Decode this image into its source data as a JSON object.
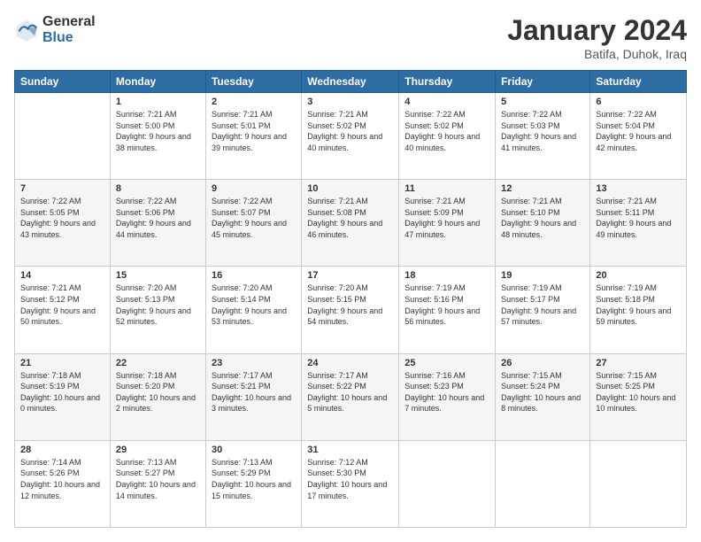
{
  "logo": {
    "general": "General",
    "blue": "Blue"
  },
  "title": "January 2024",
  "subtitle": "Batifa, Duhok, Iraq",
  "headers": [
    "Sunday",
    "Monday",
    "Tuesday",
    "Wednesday",
    "Thursday",
    "Friday",
    "Saturday"
  ],
  "weeks": [
    [
      {
        "day": "",
        "sunrise": "",
        "sunset": "",
        "daylight": ""
      },
      {
        "day": "1",
        "sunrise": "Sunrise: 7:21 AM",
        "sunset": "Sunset: 5:00 PM",
        "daylight": "Daylight: 9 hours and 38 minutes."
      },
      {
        "day": "2",
        "sunrise": "Sunrise: 7:21 AM",
        "sunset": "Sunset: 5:01 PM",
        "daylight": "Daylight: 9 hours and 39 minutes."
      },
      {
        "day": "3",
        "sunrise": "Sunrise: 7:21 AM",
        "sunset": "Sunset: 5:02 PM",
        "daylight": "Daylight: 9 hours and 40 minutes."
      },
      {
        "day": "4",
        "sunrise": "Sunrise: 7:22 AM",
        "sunset": "Sunset: 5:02 PM",
        "daylight": "Daylight: 9 hours and 40 minutes."
      },
      {
        "day": "5",
        "sunrise": "Sunrise: 7:22 AM",
        "sunset": "Sunset: 5:03 PM",
        "daylight": "Daylight: 9 hours and 41 minutes."
      },
      {
        "day": "6",
        "sunrise": "Sunrise: 7:22 AM",
        "sunset": "Sunset: 5:04 PM",
        "daylight": "Daylight: 9 hours and 42 minutes."
      }
    ],
    [
      {
        "day": "7",
        "sunrise": "Sunrise: 7:22 AM",
        "sunset": "Sunset: 5:05 PM",
        "daylight": "Daylight: 9 hours and 43 minutes."
      },
      {
        "day": "8",
        "sunrise": "Sunrise: 7:22 AM",
        "sunset": "Sunset: 5:06 PM",
        "daylight": "Daylight: 9 hours and 44 minutes."
      },
      {
        "day": "9",
        "sunrise": "Sunrise: 7:22 AM",
        "sunset": "Sunset: 5:07 PM",
        "daylight": "Daylight: 9 hours and 45 minutes."
      },
      {
        "day": "10",
        "sunrise": "Sunrise: 7:21 AM",
        "sunset": "Sunset: 5:08 PM",
        "daylight": "Daylight: 9 hours and 46 minutes."
      },
      {
        "day": "11",
        "sunrise": "Sunrise: 7:21 AM",
        "sunset": "Sunset: 5:09 PM",
        "daylight": "Daylight: 9 hours and 47 minutes."
      },
      {
        "day": "12",
        "sunrise": "Sunrise: 7:21 AM",
        "sunset": "Sunset: 5:10 PM",
        "daylight": "Daylight: 9 hours and 48 minutes."
      },
      {
        "day": "13",
        "sunrise": "Sunrise: 7:21 AM",
        "sunset": "Sunset: 5:11 PM",
        "daylight": "Daylight: 9 hours and 49 minutes."
      }
    ],
    [
      {
        "day": "14",
        "sunrise": "Sunrise: 7:21 AM",
        "sunset": "Sunset: 5:12 PM",
        "daylight": "Daylight: 9 hours and 50 minutes."
      },
      {
        "day": "15",
        "sunrise": "Sunrise: 7:20 AM",
        "sunset": "Sunset: 5:13 PM",
        "daylight": "Daylight: 9 hours and 52 minutes."
      },
      {
        "day": "16",
        "sunrise": "Sunrise: 7:20 AM",
        "sunset": "Sunset: 5:14 PM",
        "daylight": "Daylight: 9 hours and 53 minutes."
      },
      {
        "day": "17",
        "sunrise": "Sunrise: 7:20 AM",
        "sunset": "Sunset: 5:15 PM",
        "daylight": "Daylight: 9 hours and 54 minutes."
      },
      {
        "day": "18",
        "sunrise": "Sunrise: 7:19 AM",
        "sunset": "Sunset: 5:16 PM",
        "daylight": "Daylight: 9 hours and 56 minutes."
      },
      {
        "day": "19",
        "sunrise": "Sunrise: 7:19 AM",
        "sunset": "Sunset: 5:17 PM",
        "daylight": "Daylight: 9 hours and 57 minutes."
      },
      {
        "day": "20",
        "sunrise": "Sunrise: 7:19 AM",
        "sunset": "Sunset: 5:18 PM",
        "daylight": "Daylight: 9 hours and 59 minutes."
      }
    ],
    [
      {
        "day": "21",
        "sunrise": "Sunrise: 7:18 AM",
        "sunset": "Sunset: 5:19 PM",
        "daylight": "Daylight: 10 hours and 0 minutes."
      },
      {
        "day": "22",
        "sunrise": "Sunrise: 7:18 AM",
        "sunset": "Sunset: 5:20 PM",
        "daylight": "Daylight: 10 hours and 2 minutes."
      },
      {
        "day": "23",
        "sunrise": "Sunrise: 7:17 AM",
        "sunset": "Sunset: 5:21 PM",
        "daylight": "Daylight: 10 hours and 3 minutes."
      },
      {
        "day": "24",
        "sunrise": "Sunrise: 7:17 AM",
        "sunset": "Sunset: 5:22 PM",
        "daylight": "Daylight: 10 hours and 5 minutes."
      },
      {
        "day": "25",
        "sunrise": "Sunrise: 7:16 AM",
        "sunset": "Sunset: 5:23 PM",
        "daylight": "Daylight: 10 hours and 7 minutes."
      },
      {
        "day": "26",
        "sunrise": "Sunrise: 7:15 AM",
        "sunset": "Sunset: 5:24 PM",
        "daylight": "Daylight: 10 hours and 8 minutes."
      },
      {
        "day": "27",
        "sunrise": "Sunrise: 7:15 AM",
        "sunset": "Sunset: 5:25 PM",
        "daylight": "Daylight: 10 hours and 10 minutes."
      }
    ],
    [
      {
        "day": "28",
        "sunrise": "Sunrise: 7:14 AM",
        "sunset": "Sunset: 5:26 PM",
        "daylight": "Daylight: 10 hours and 12 minutes."
      },
      {
        "day": "29",
        "sunrise": "Sunrise: 7:13 AM",
        "sunset": "Sunset: 5:27 PM",
        "daylight": "Daylight: 10 hours and 14 minutes."
      },
      {
        "day": "30",
        "sunrise": "Sunrise: 7:13 AM",
        "sunset": "Sunset: 5:29 PM",
        "daylight": "Daylight: 10 hours and 15 minutes."
      },
      {
        "day": "31",
        "sunrise": "Sunrise: 7:12 AM",
        "sunset": "Sunset: 5:30 PM",
        "daylight": "Daylight: 10 hours and 17 minutes."
      },
      {
        "day": "",
        "sunrise": "",
        "sunset": "",
        "daylight": ""
      },
      {
        "day": "",
        "sunrise": "",
        "sunset": "",
        "daylight": ""
      },
      {
        "day": "",
        "sunrise": "",
        "sunset": "",
        "daylight": ""
      }
    ]
  ]
}
